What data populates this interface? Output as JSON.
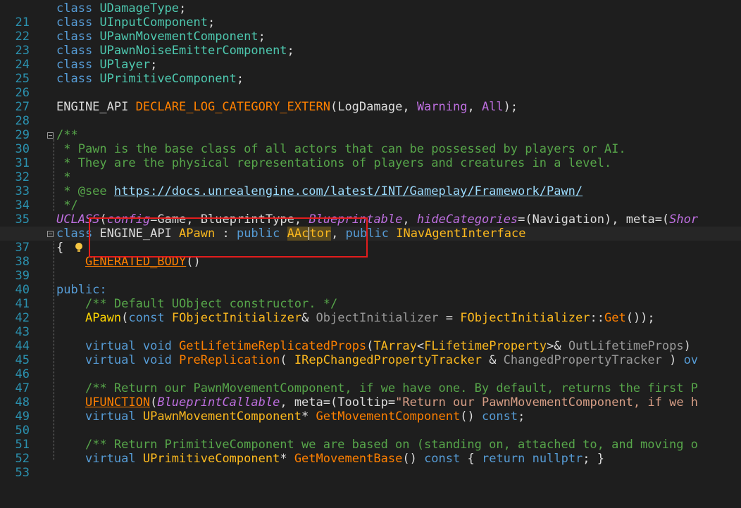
{
  "line_numbers": [
    "21",
    "22",
    "23",
    "24",
    "25",
    "26",
    "27",
    "28",
    "29",
    "30",
    "31",
    "32",
    "33",
    "34",
    "35",
    "36",
    "37",
    "38",
    "39",
    "40",
    "41",
    "42",
    "43",
    "44",
    "45",
    "46",
    "47",
    "48",
    "49",
    "50",
    "51",
    "52",
    "53"
  ],
  "tokens": {
    "class": "class",
    "udamagetype": "UDamageType",
    "uinputcomponent": "UInputComponent",
    "upawnmovementcomponent": "UPawnMovementComponent",
    "upawnnoiseemittercomponent": "UPawnNoiseEmitterComponent",
    "uplayer": "UPlayer",
    "uprimitivecomponent": "UPrimitiveComponent",
    "semi": ";",
    "engine_api": "ENGINE_API",
    "declare_log": "DECLARE_LOG_CATEGORY_EXTERN",
    "logdamage": "LogDamage",
    "warning": "Warning",
    "all": "All",
    "c30": "/**",
    "c31": " * Pawn is the base class of all actors that can be possessed by players or AI.",
    "c32": " * They are the physical representations of players and creatures in a level.",
    "c33": " *",
    "c34a": " * @see ",
    "c34link": "https://docs.unrealengine.com/latest/INT/Gameplay/Framework/Pawn/",
    "c35": " */",
    "uclass": "UCLASS",
    "config": "config",
    "game": "Game",
    "blueprinttype": "BlueprintType",
    "blueprintable": "Blueprintable",
    "hidecategories": "hideCategories",
    "navigation": "Navigation",
    "meta": "meta",
    "short": "Shor",
    "apawn": "APawn",
    "public": "public",
    "aa": "AAc",
    "tor": "tor",
    "inavagentinterface": "INavAgentInterface",
    "brace_open": "{",
    "generated_body": "GENERATED_BODY",
    "parens": "()",
    "public_label": "public:",
    "c42": "/** Default UObject constructor. */",
    "const": "const",
    "fobjectinitializer": "FObjectInitializer",
    "objectinitializer": "ObjectInitializer",
    "get": "Get",
    "virtual": "virtual",
    "void": "void",
    "getlifetime": "GetLifetimeReplicatedProps",
    "tarray": "TArray",
    "flifetimeproperty": "FLifetimeProperty",
    "outlifetimeprops": "OutLifetimeProps",
    "prereplication": "PreReplication",
    "irepchanged": "IRepChangedPropertyTracker",
    "changedtracker": "ChangedPropertyTracker",
    "ov": "ov",
    "c48": "/** Return our PawnMovementComponent, if we have one. By default, returns the first P",
    "ufunction": "UFUNCTION",
    "blueprintcallable": "BlueprintCallable",
    "tooltip": "Tooltip",
    "tooltip_str": "\"Return our PawnMovementComponent, if we h",
    "getmovementcomponent": "GetMovementComponent",
    "c52": "/** Return PrimitiveComponent we are based on (standing on, attached to, and moving o",
    "getmovementbase": "GetMovementBase",
    "return": "return",
    "nullptr": "nullptr"
  },
  "colors": {
    "background": "#1e1e1e",
    "line_number": "#2b91af",
    "keyword": "#569cd6",
    "comment": "#57a64a",
    "highlight_box": "#e21d1d",
    "class_name": "#fcb91e",
    "function": "#ff8000"
  },
  "icons": {
    "fold": "collapse-toggle-icon",
    "lightbulb": "lightbulb-icon"
  }
}
